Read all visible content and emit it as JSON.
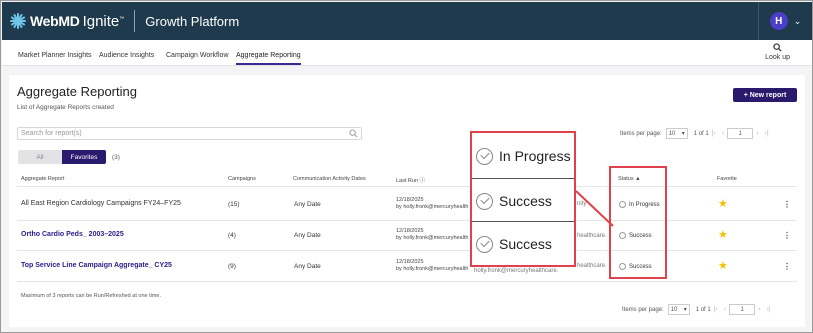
{
  "header": {
    "brand": "WebMD",
    "product": "Ignite",
    "tm": "™",
    "platform": "Growth Platform",
    "avatar_initial": "H",
    "colors": {
      "bar": "#1f3a4d",
      "avatar": "#4a3fc6"
    }
  },
  "nav": {
    "tabs": [
      {
        "label": "Market Planner Insights"
      },
      {
        "label": "Audience Insights"
      },
      {
        "label": "Campaign Workflow"
      },
      {
        "label": "Aggregate Reporting",
        "active": true
      }
    ],
    "lookup_label": "Look up"
  },
  "page": {
    "title": "Aggregate Reporting",
    "subtitle": "List of Aggregate Reports created",
    "new_report_label": "+ New report",
    "search_placeholder": "Search for report(s)",
    "top_pager": {
      "items_label": "Items per page:",
      "items_value": "10",
      "range_label": "1 of 1",
      "page_value": "1"
    },
    "bottom_pager": {
      "items_label": "Items per page:",
      "items_value": "10",
      "range_label": "1 of 1",
      "page_value": "1"
    },
    "segment": {
      "all_label": "All",
      "favorites_label": "Favorites",
      "count": "(3)"
    },
    "accent_color": "#2a1a6e"
  },
  "table": {
    "columns": {
      "report": "Aggregate Report",
      "campaigns": "Campaigns",
      "dates": "Communication Activity Dates",
      "lastrun": "Last Run",
      "status": "Status",
      "favorite": "Favorite"
    },
    "rows": [
      {
        "name": "All East Region Cardiology Campaigns FY24–FY25",
        "campaigns": "(15)",
        "dates": "Any Date",
        "run_date": "12/18/2025",
        "run_by": "by holly.fronk@mercuryhealth",
        "status": "In Progress"
      },
      {
        "name": "Ortho Cardio Peds_ 2003–2025",
        "campaigns": "(4)",
        "dates": "Any Date",
        "run_date": "12/18/2025",
        "run_by": "by holly.fronk@mercuryhealth",
        "status": "Success"
      },
      {
        "name": "Top Service Line Campaign Aggregate_ CY25",
        "campaigns": "(9)",
        "dates": "Any Date",
        "run_date": "12/18/2025",
        "run_by": "by holly.fronk@mercuryhealth",
        "status": "Success"
      }
    ],
    "partial_behind_zoom": [
      "nity",
      "healthcare.",
      "healthcare.",
      "holly.fronk@mercuryhealthcare."
    ]
  },
  "footer_note": "Maximum of 3 reports can be Run/Refreshed at one time.",
  "zoom_callout": {
    "items": [
      "In Progress",
      "Success",
      "Success"
    ],
    "highlight_color": "#e0424b"
  }
}
